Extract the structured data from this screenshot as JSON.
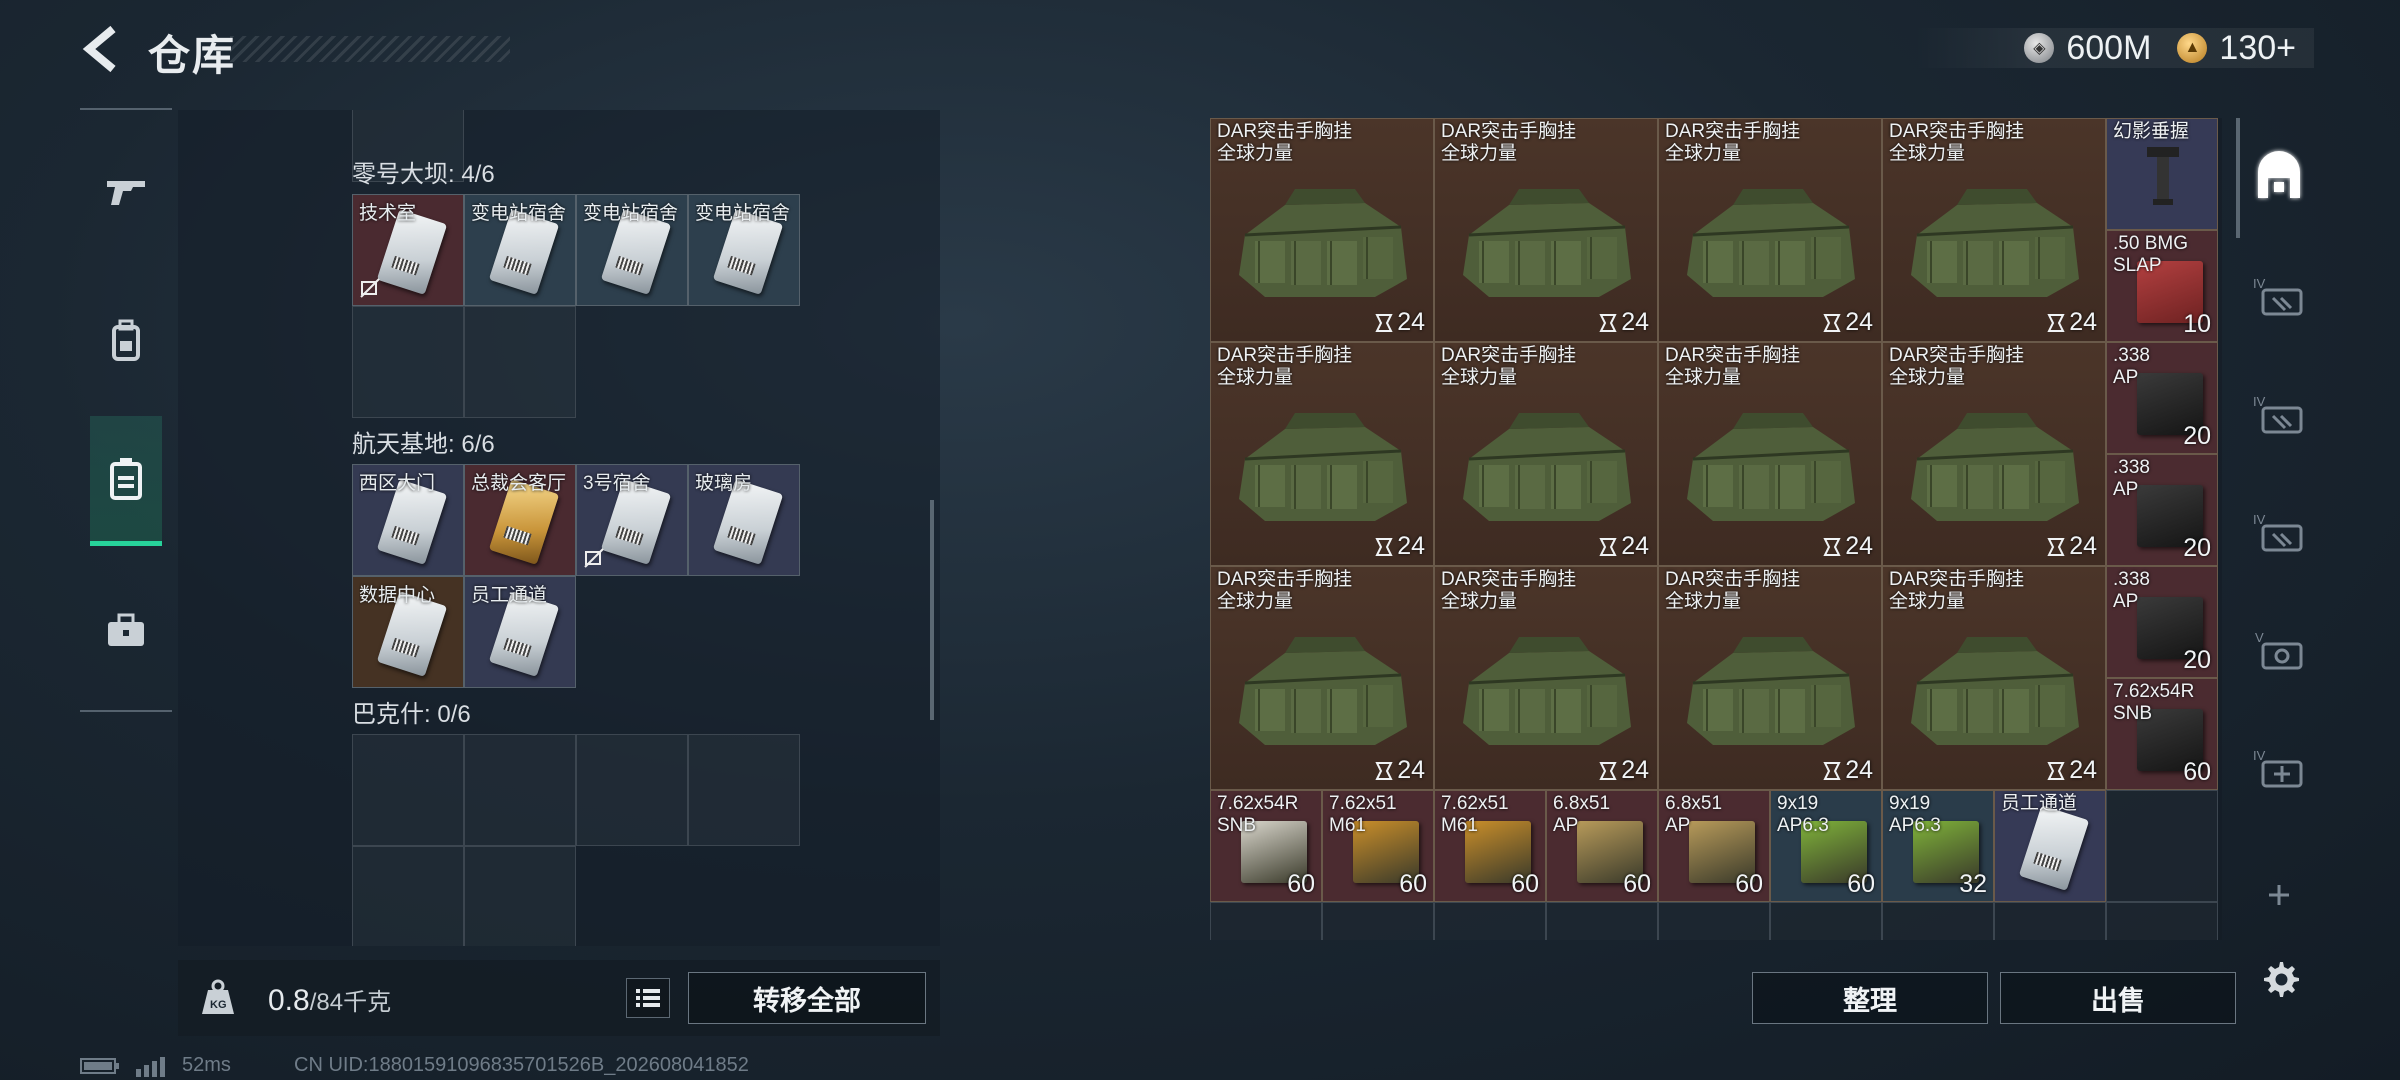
{
  "header": {
    "title": "仓库",
    "currency": [
      {
        "icon": "silver-coin-icon",
        "value": "600M"
      },
      {
        "icon": "gold-coin-icon",
        "value": "130+"
      }
    ]
  },
  "left_rail": {
    "items": [
      {
        "name": "weapons",
        "icon": "gun-icon",
        "active": false
      },
      {
        "name": "equipment",
        "icon": "backpack-icon",
        "active": false
      },
      {
        "name": "keycards",
        "icon": "keycard-holder-icon",
        "active": true
      },
      {
        "name": "items",
        "icon": "briefcase-icon",
        "active": false
      }
    ]
  },
  "key_groups": [
    {
      "label": "零号大坝: 4/6",
      "cards": [
        {
          "name": "技术室",
          "color": "red",
          "no_trade": true
        },
        {
          "name": "变电站宿舍",
          "color": "blue",
          "no_trade": false
        },
        {
          "name": "变电站宿舍",
          "color": "blue",
          "no_trade": false
        },
        {
          "name": "变电站宿舍",
          "color": "blue",
          "no_trade": false
        }
      ]
    },
    {
      "label": "航天基地: 6/6",
      "cards": [
        {
          "name": "西区大门",
          "color": "purple",
          "no_trade": false
        },
        {
          "name": "总裁会客厅",
          "color": "red",
          "no_trade": false,
          "gold": true
        },
        {
          "name": "3号宿舍",
          "color": "purple",
          "no_trade": true
        },
        {
          "name": "玻璃房",
          "color": "purple",
          "no_trade": false
        },
        {
          "name": "数据中心",
          "color": "brown",
          "no_trade": false
        },
        {
          "name": "员工通道",
          "color": "purple",
          "no_trade": false
        }
      ]
    },
    {
      "label": "巴克什: 0/6",
      "cards": []
    }
  ],
  "weight": {
    "current": "0.8",
    "max": "/84千克"
  },
  "left_actions": {
    "transfer_all": "转移全部"
  },
  "stash": {
    "bags": [
      {
        "name": "DAR突击手胸挂\n全球力量",
        "durability": "24"
      },
      {
        "name": "DAR突击手胸挂\n全球力量",
        "durability": "24"
      },
      {
        "name": "DAR突击手胸挂\n全球力量",
        "durability": "24"
      },
      {
        "name": "DAR突击手胸挂\n全球力量",
        "durability": "24"
      },
      {
        "name": "DAR突击手胸挂\n全球力量",
        "durability": "24"
      },
      {
        "name": "DAR突击手胸挂\n全球力量",
        "durability": "24"
      },
      {
        "name": "DAR突击手胸挂\n全球力量",
        "durability": "24"
      },
      {
        "name": "DAR突击手胸挂\n全球力量",
        "durability": "24"
      },
      {
        "name": "DAR突击手胸挂\n全球力量",
        "durability": "24"
      },
      {
        "name": "DAR突击手胸挂\n全球力量",
        "durability": "24"
      },
      {
        "name": "DAR突击手胸挂\n全球力量",
        "durability": "24"
      },
      {
        "name": "DAR突击手胸挂\n全球力量",
        "durability": "24"
      }
    ],
    "side_column": [
      {
        "name": "幻影垂握",
        "count": "",
        "color": "purple"
      },
      {
        "name": ".50 BMG\nSLAP",
        "count": "10",
        "color": "red"
      },
      {
        "name": ".338\nAP",
        "count": "20",
        "color": "red"
      },
      {
        "name": ".338\nAP",
        "count": "20",
        "color": "red"
      },
      {
        "name": ".338\nAP",
        "count": "20",
        "color": "red"
      },
      {
        "name": "7.62x54R\nSNB",
        "count": "60",
        "color": "red"
      }
    ],
    "bottom_row": [
      {
        "name": "7.62x54R\nSNB",
        "count": "60",
        "color": "red"
      },
      {
        "name": "7.62x51\nM61",
        "count": "60",
        "color": "red"
      },
      {
        "name": "7.62x51\nM61",
        "count": "60",
        "color": "red"
      },
      {
        "name": "6.8x51\nAP",
        "count": "60",
        "color": "red"
      },
      {
        "name": "6.8x51\nAP",
        "count": "60",
        "color": "red"
      },
      {
        "name": "9x19\nAP6.3",
        "count": "60",
        "color": "blue"
      },
      {
        "name": "9x19\nAP6.3",
        "count": "32",
        "color": "blue"
      },
      {
        "name": "员工通道",
        "count": "",
        "color": "purple"
      }
    ]
  },
  "right_rail": {
    "items": [
      {
        "icon": "stash-tab-icon",
        "active": true
      },
      {
        "icon": "ext-storage-1-icon",
        "label": "IV"
      },
      {
        "icon": "ext-storage-2-icon",
        "label": "IV"
      },
      {
        "icon": "ext-storage-3-icon",
        "label": "IV"
      },
      {
        "icon": "ext-storage-4-icon",
        "label": "V"
      },
      {
        "icon": "ext-storage-5-icon",
        "label": "IV"
      },
      {
        "icon": "add-storage-icon",
        "label": "+"
      }
    ]
  },
  "right_actions": {
    "sort": "整理",
    "sell": "出售"
  },
  "status": {
    "ping": "52ms",
    "uid": "CN UID:18801591096835701526B_202608041852"
  }
}
